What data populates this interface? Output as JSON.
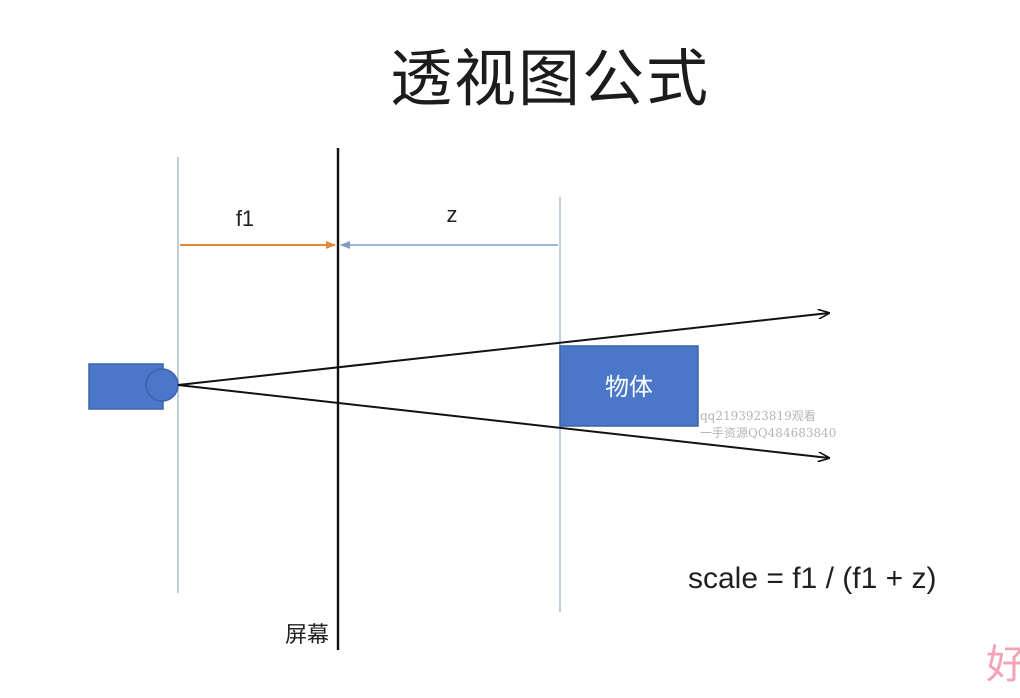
{
  "title": "透视图公式",
  "labels": {
    "f1": "f1",
    "z": "z",
    "object": "物体",
    "screen": "屏幕"
  },
  "formula": "scale = f1 / (f1 + z)",
  "watermark": {
    "line1": "qq2193923819观看",
    "line2": "一手资源QQ484683840"
  },
  "corner_logo": "好",
  "colors": {
    "box_fill": "#4a77c8",
    "box_stroke": "#3b63ad",
    "guide_line": "#9fb3cf",
    "f1_arrow": "#e0883c",
    "z_arrow": "#7f9cc6",
    "ray": "#111111"
  },
  "icons": {
    "camera": "camera-icon"
  }
}
